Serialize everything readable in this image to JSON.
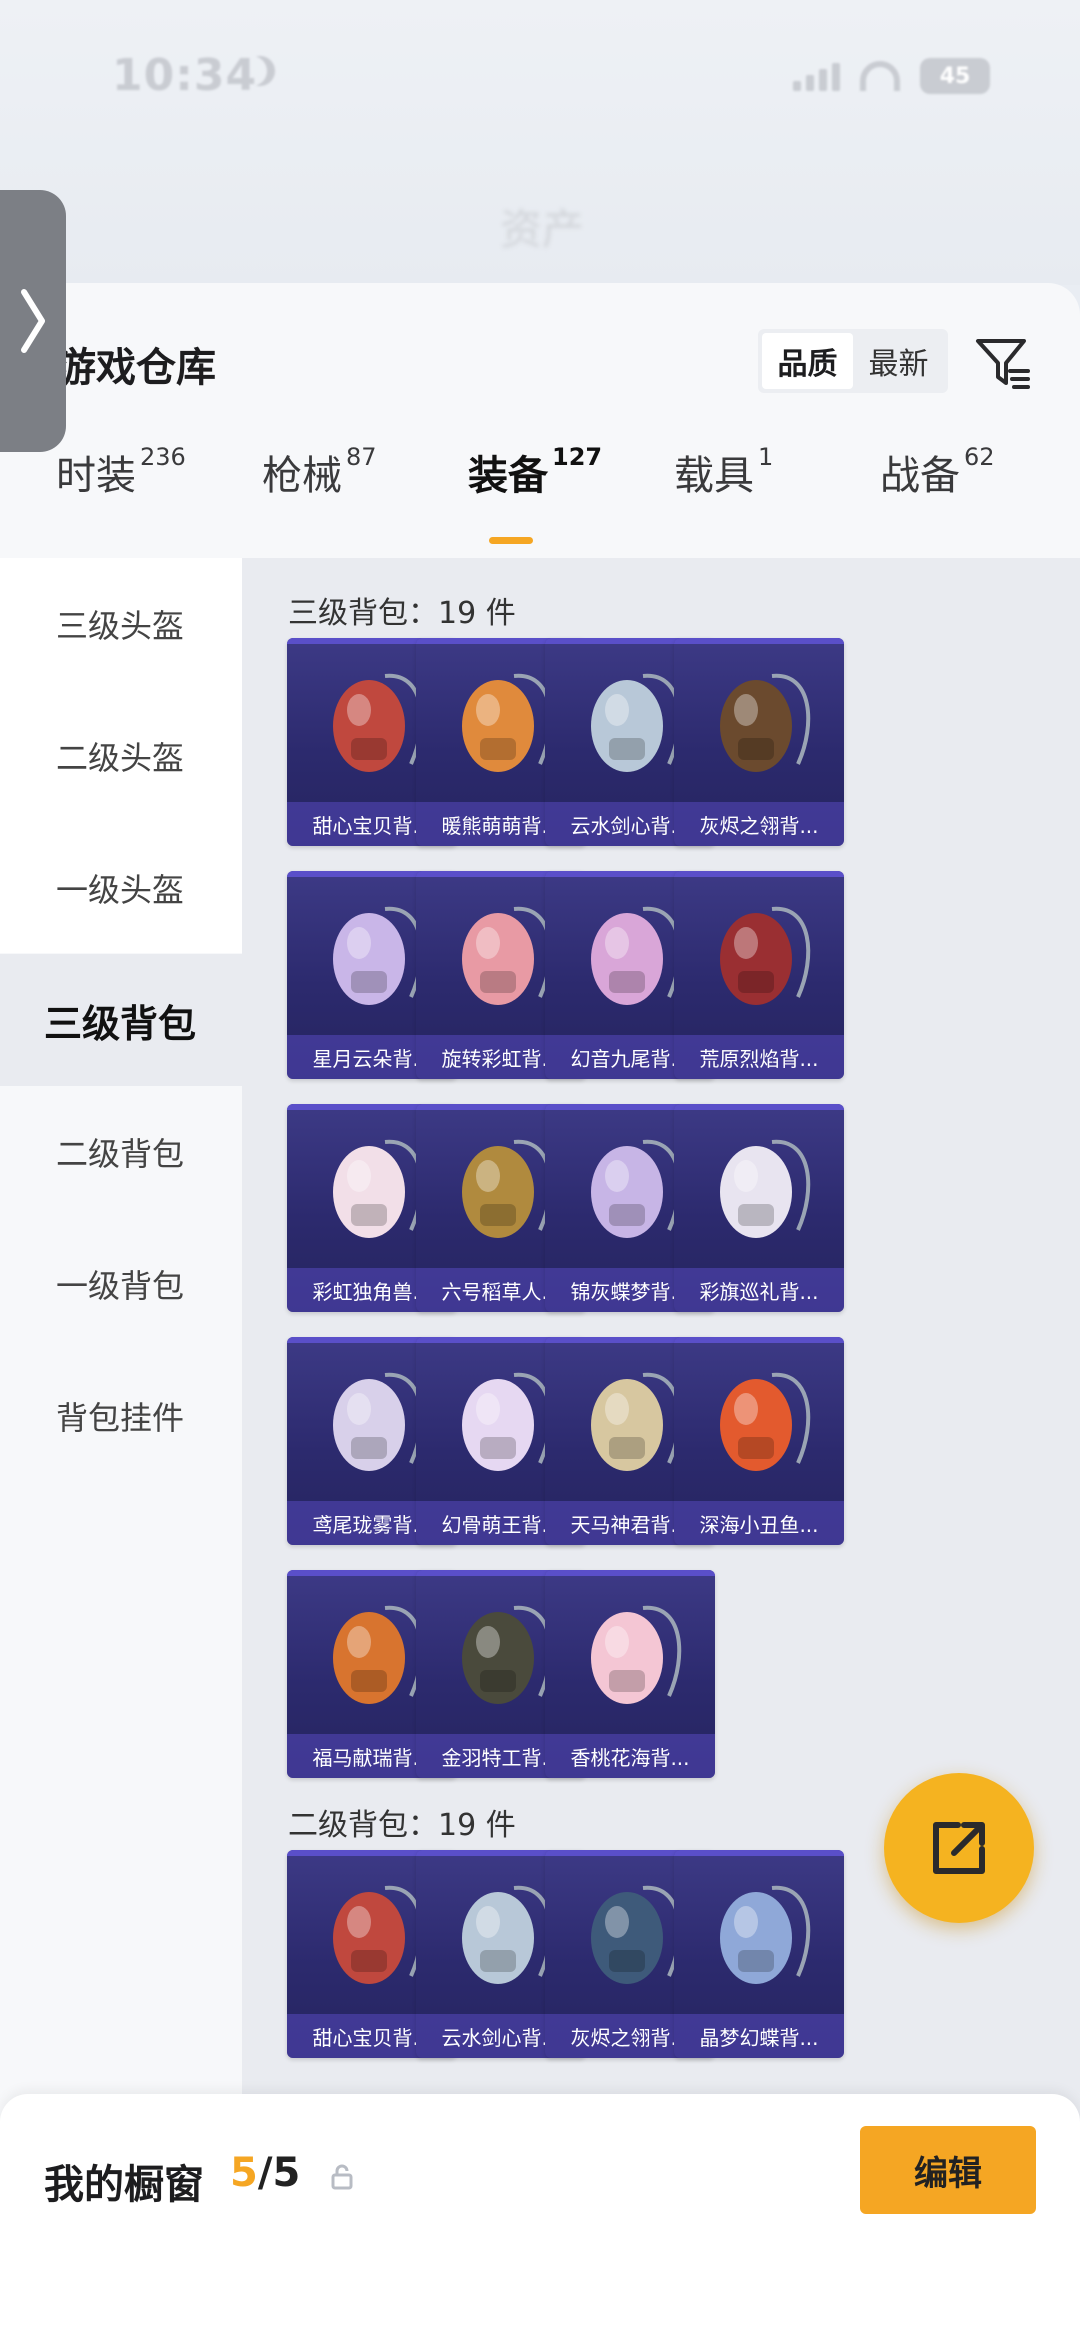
{
  "status_bar": {
    "time": "10:34",
    "battery": "45"
  },
  "backdrop_title": "资产",
  "sheet": {
    "title": "游戏仓库",
    "sort_options": [
      "品质",
      "最新"
    ],
    "active_sort": "品质"
  },
  "tabs": [
    {
      "label": "时装",
      "count": "236"
    },
    {
      "label": "枪械",
      "count": "87"
    },
    {
      "label": "装备",
      "count": "127"
    },
    {
      "label": "载具",
      "count": "1"
    },
    {
      "label": "战备",
      "count": "62"
    }
  ],
  "active_tab": "装备",
  "side_menu": [
    {
      "label": "三级头盔"
    },
    {
      "label": "二级头盔"
    },
    {
      "label": "一级头盔"
    },
    {
      "label": "三级背包"
    },
    {
      "label": "二级背包"
    },
    {
      "label": "一级背包"
    },
    {
      "label": "背包挂件"
    }
  ],
  "active_side": "三级背包",
  "sections": [
    {
      "title": "三级背包：19 件",
      "items": [
        {
          "name": "甜心宝贝背...",
          "art": "cake-backpack-icon",
          "color": "#c0483e"
        },
        {
          "name": "暖熊萌萌背...",
          "art": "bear-backpack-icon",
          "color": "#e08a3c"
        },
        {
          "name": "云水剑心背...",
          "art": "sword-backpack-icon",
          "color": "#b8c8d8"
        },
        {
          "name": "灰烬之翎背...",
          "art": "ember-backpack-icon",
          "color": "#6b4a2e"
        },
        {
          "name": "星月云朵背...",
          "art": "cloud-backpack-icon",
          "color": "#c9b6e8"
        },
        {
          "name": "旋转彩虹背...",
          "art": "rainbow-backpack-icon",
          "color": "#e89aa4"
        },
        {
          "name": "幻音九尾背...",
          "art": "fox-backpack-icon",
          "color": "#d9a6d8"
        },
        {
          "name": "荒原烈焰背...",
          "art": "flame-backpack-icon",
          "color": "#9a2f32"
        },
        {
          "name": "彩虹独角兽...",
          "art": "unicorn-backpack-icon",
          "color": "#f2dfe8"
        },
        {
          "name": "六号稻草人...",
          "art": "scarecrow-backpack-icon",
          "color": "#b08a3e"
        },
        {
          "name": "锦灰蝶梦背...",
          "art": "butterfly-backpack-icon",
          "color": "#c7b5e6"
        },
        {
          "name": "彩旗巡礼背...",
          "art": "flag-backpack-icon",
          "color": "#e8e4f0"
        },
        {
          "name": "鸢尾珑雾背...",
          "art": "iris-backpack-icon",
          "color": "#d8d0ea"
        },
        {
          "name": "幻骨萌王背...",
          "art": "bone-backpack-icon",
          "color": "#e6d8f2"
        },
        {
          "name": "天马神君背...",
          "art": "pegasus-backpack-icon",
          "color": "#d7c7a0"
        },
        {
          "name": "深海小丑鱼...",
          "art": "clownfish-backpack-icon",
          "color": "#e35a2e"
        },
        {
          "name": "福马献瑞背...",
          "art": "horse-backpack-icon",
          "color": "#d8742f"
        },
        {
          "name": "金羽特工背...",
          "art": "tactical-backpack-icon",
          "color": "#4a4a3c"
        },
        {
          "name": "香桃花海背...",
          "art": "peach-backpack-icon",
          "color": "#f4c6d4"
        }
      ]
    },
    {
      "title": "二级背包：19 件",
      "items": [
        {
          "name": "甜心宝贝背...",
          "art": "cake-backpack-icon",
          "color": "#c0483e"
        },
        {
          "name": "云水剑心背...",
          "art": "sword-backpack-icon",
          "color": "#b8c8d8"
        },
        {
          "name": "灰烬之翎背...",
          "art": "ember-backpack-icon",
          "color": "#3e5a7a"
        },
        {
          "name": "晶梦幻蝶背...",
          "art": "crystal-backpack-icon",
          "color": "#8fa8d8"
        }
      ]
    }
  ],
  "bottom_bar": {
    "label": "我的橱窗",
    "current": "5",
    "separator": "/",
    "total": "5",
    "edit_label": "编辑"
  },
  "colors": {
    "accent": "#f5a623",
    "card_bg": "#2c2a6e",
    "card_label_bg": "#5648be"
  }
}
